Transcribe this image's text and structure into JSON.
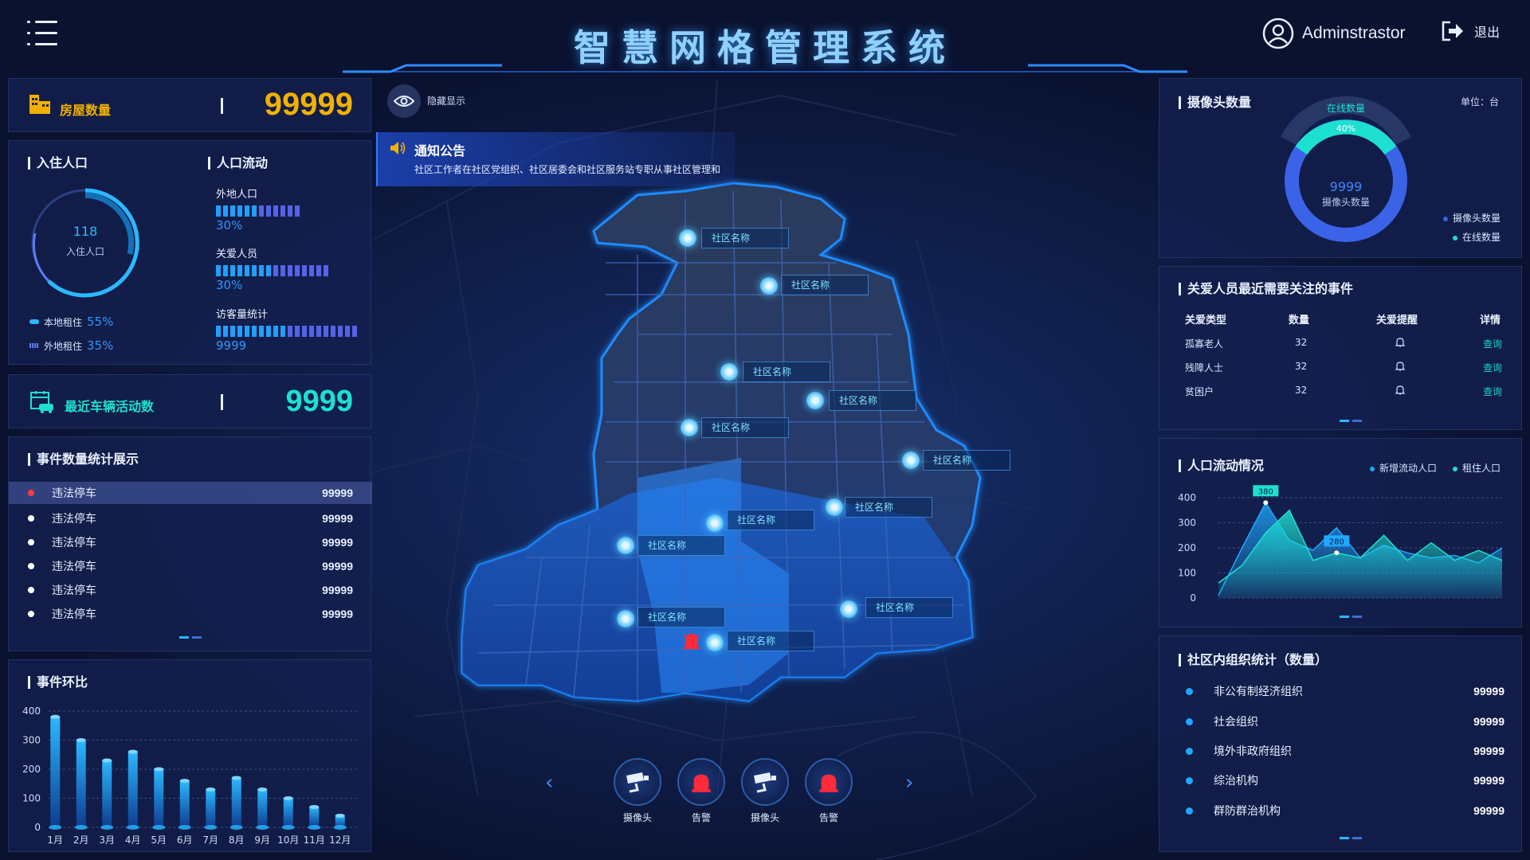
{
  "header": {
    "title": "智慧网格管理系统",
    "user": "Adminstrastor",
    "logout": "退出"
  },
  "house": {
    "label": "房屋数量",
    "value": "99999"
  },
  "population": {
    "title": "入住人口",
    "center_value": "118",
    "center_label": "入住人口",
    "local_label": "本地租住",
    "local_pct": "55%",
    "outside_label": "外地租住",
    "outside_pct": "35%"
  },
  "flow": {
    "title": "人口流动",
    "items": [
      {
        "label": "外地人口",
        "value": "30%",
        "level": 0.6
      },
      {
        "label": "关爱人员",
        "value": "30%",
        "level": 0.8
      },
      {
        "label": "访客量统计",
        "value": "9999",
        "level": 1.0
      }
    ]
  },
  "vehicle": {
    "label": "最近车辆活动数",
    "value": "9999"
  },
  "events": {
    "title": "事件数量统计展示",
    "rows": [
      {
        "name": "违法停车",
        "value": "99999"
      },
      {
        "name": "违法停车",
        "value": "99999"
      },
      {
        "name": "违法停车",
        "value": "99999"
      },
      {
        "name": "违法停车",
        "value": "99999"
      },
      {
        "name": "违法停车",
        "value": "99999"
      },
      {
        "name": "违法停车",
        "value": "99999"
      }
    ]
  },
  "event_ratio": {
    "title": "事件环比"
  },
  "eye": {
    "label": "隐藏显示"
  },
  "notice": {
    "title": "通知公告",
    "text": "社区工作者在社区党组织、社区居委会和社区服务站专职从事社区管理和"
  },
  "map": {
    "community_label": "社区名称"
  },
  "bottom_nav": [
    {
      "label": "摄像头",
      "icon": "camera-icon"
    },
    {
      "label": "告警",
      "icon": "alarm-icon"
    },
    {
      "label": "摄像头",
      "icon": "camera-icon"
    },
    {
      "label": "告警",
      "icon": "alarm-icon"
    }
  ],
  "cameras": {
    "title": "摄像头数量",
    "unit": "单位：台",
    "online_label": "在线数量",
    "online_pct": "40%",
    "total": "9999",
    "total_label": "摄像头数量",
    "legend": [
      "摄像头数量",
      "在线数量"
    ],
    "colors": {
      "total": "#3a63e8",
      "online": "#1de0d0"
    }
  },
  "care": {
    "title": "关爱人员最近需要关注的事件",
    "headers": [
      "关爱类型",
      "数量",
      "关爱提醒",
      "详情"
    ],
    "rows": [
      {
        "type": "孤寡老人",
        "count": "32",
        "link": "查询"
      },
      {
        "type": "残障人士",
        "count": "32",
        "link": "查询"
      },
      {
        "type": "贫困户",
        "count": "32",
        "link": "查询"
      }
    ]
  },
  "org": {
    "title": "社区内组织统计（数量）",
    "rows": [
      {
        "name": "非公有制经济组织",
        "value": "99999"
      },
      {
        "name": "社会组织",
        "value": "99999"
      },
      {
        "name": "境外非政府组织",
        "value": "99999"
      },
      {
        "name": "综治机构",
        "value": "99999"
      },
      {
        "name": "群防群治机构",
        "value": "99999"
      }
    ]
  },
  "chart_data": [
    {
      "type": "bar",
      "title": "事件环比",
      "categories": [
        "1月",
        "2月",
        "3月",
        "4月",
        "5月",
        "6月",
        "7月",
        "8月",
        "9月",
        "10月",
        "11月",
        "12月"
      ],
      "values": [
        380,
        300,
        230,
        260,
        200,
        160,
        130,
        170,
        130,
        100,
        70,
        40
      ],
      "ylim": [
        0,
        400
      ],
      "yticks": [
        0,
        100,
        200,
        300,
        400
      ],
      "grid": true
    },
    {
      "type": "area",
      "title": "人口流动情况",
      "x": [
        0,
        1,
        2,
        3,
        4,
        5,
        6,
        7,
        8,
        9,
        10,
        11,
        12
      ],
      "series": [
        {
          "name": "新增流动人口",
          "values": [
            10,
            200,
            380,
            230,
            190,
            280,
            160,
            210,
            180,
            160,
            170,
            140,
            200
          ]
        },
        {
          "name": "租住人口",
          "values": [
            60,
            130,
            260,
            350,
            150,
            180,
            160,
            250,
            150,
            220,
            150,
            190,
            150
          ]
        }
      ],
      "ylim": [
        0,
        400
      ],
      "yticks": [
        0,
        100,
        200,
        300,
        400
      ],
      "point_labels": [
        "380",
        "280"
      ],
      "legend": "top-right",
      "grid": true
    }
  ]
}
